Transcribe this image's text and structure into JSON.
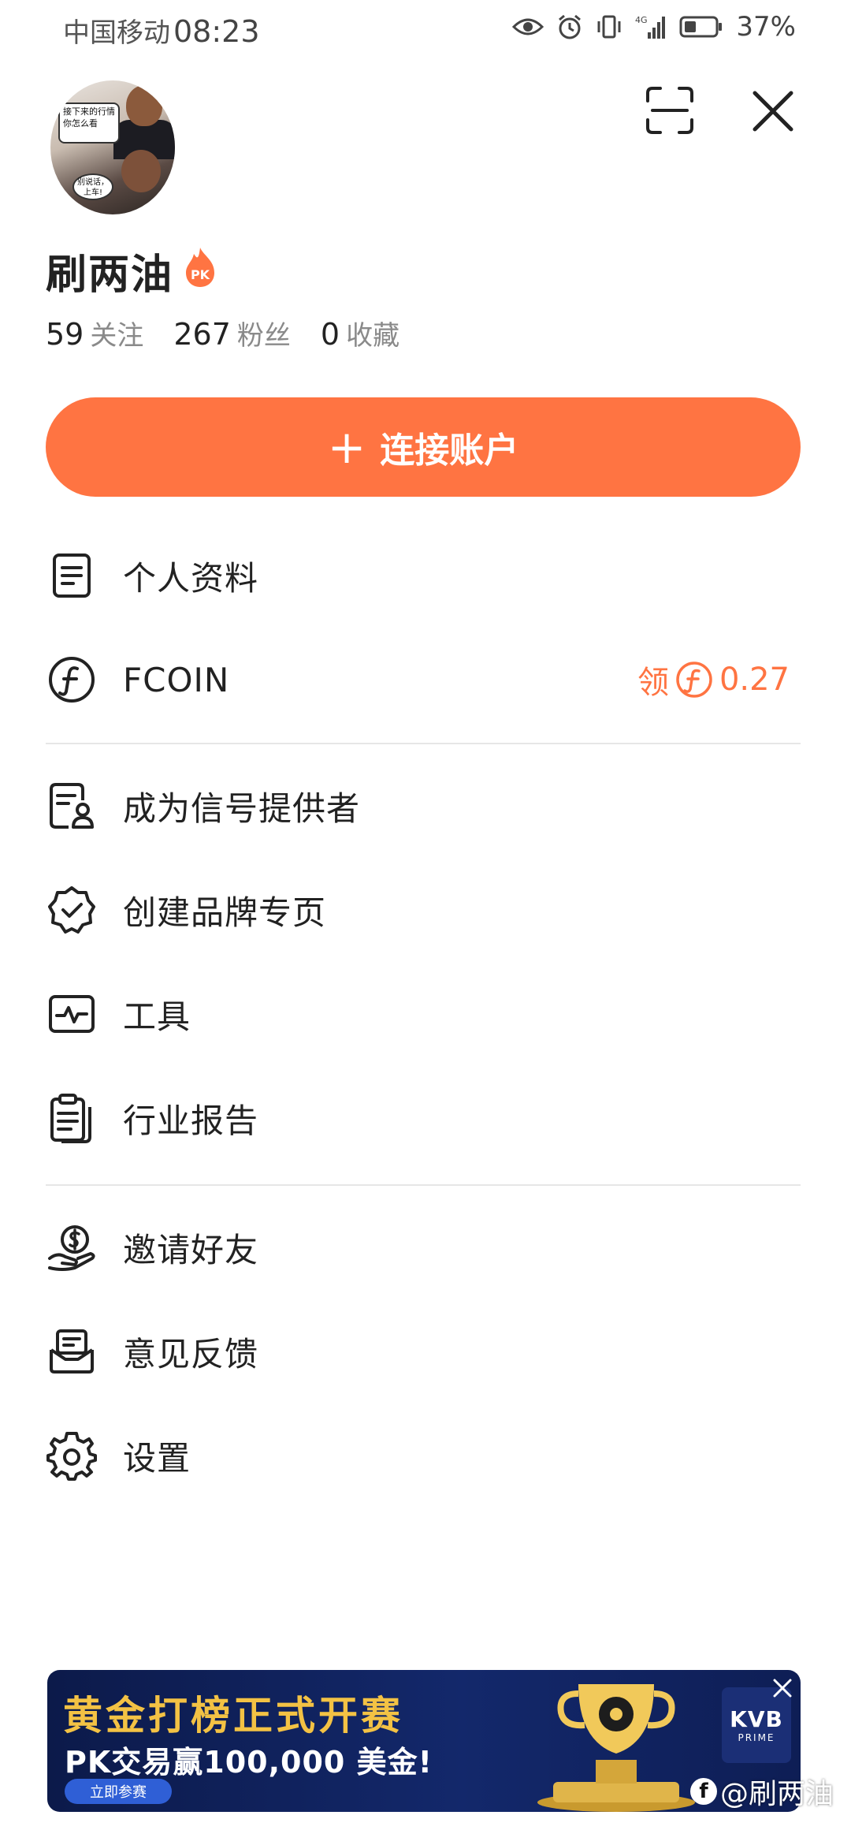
{
  "status_bar": {
    "carrier": "中国移动",
    "time": "08:23",
    "network": "4G",
    "battery": "37%"
  },
  "profile": {
    "avatar_text_top": "接下来的行情你怎么看",
    "avatar_text_bottom": "别说话，上车!",
    "username": "刷两油",
    "badge": "PK",
    "stats": [
      {
        "value": "59",
        "label": "关注"
      },
      {
        "value": "267",
        "label": "粉丝"
      },
      {
        "value": "0",
        "label": "收藏"
      }
    ]
  },
  "connect_button": {
    "plus": "+",
    "label": "连接账户"
  },
  "menu": [
    {
      "icon": "document-icon",
      "label": "个人资料"
    },
    {
      "icon": "fcoin-icon",
      "label": "FCOIN",
      "right_prefix": "领",
      "right_value": "0.27"
    },
    {
      "icon": "signal-provider-icon",
      "label": "成为信号提供者"
    },
    {
      "icon": "verified-badge-icon",
      "label": "创建品牌专页"
    },
    {
      "icon": "pulse-monitor-icon",
      "label": "工具"
    },
    {
      "icon": "report-clipboard-icon",
      "label": "行业报告"
    },
    {
      "icon": "invite-coin-hand-icon",
      "label": "邀请好友"
    },
    {
      "icon": "feedback-mail-icon",
      "label": "意见反馈"
    },
    {
      "icon": "gear-icon",
      "label": "设置"
    }
  ],
  "banner": {
    "title": "黄金打榜正式开赛",
    "subtitle": "PK交易赢100,000 美金!",
    "cta": "立即参赛",
    "brand": "KVB",
    "brand_sub": "PRIME"
  },
  "watermark": {
    "platform": "f",
    "text": "@刷两油"
  },
  "colors": {
    "accent": "#ff7442",
    "banner_bg": "#13286b",
    "banner_title": "#f3c244"
  }
}
